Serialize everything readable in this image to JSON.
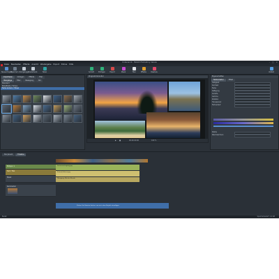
{
  "app": {
    "title": "Unbenannt - MAGIX Photostory deluxe"
  },
  "menu": [
    "Datei",
    "Bearbeiten",
    "Effekte",
    "Ansicht",
    "Wiedergabe",
    "Export",
    "Extras",
    "Hilfe"
  ],
  "toolbar": [
    {
      "label": "Neues Projekt",
      "icon": "new-project-icon",
      "color": "#5a8fd0"
    },
    {
      "label": "Speichern",
      "icon": "save-icon",
      "color": "#6f7d8c"
    },
    {
      "label": "Rückgängig",
      "icon": "undo-icon",
      "color": "#c5cdd6"
    },
    {
      "label": "Wiederherst.",
      "icon": "redo-icon",
      "color": "#c5cdd6"
    },
    {
      "label": "Teilen",
      "icon": "share-icon",
      "color": "#2fa3a3"
    },
    {
      "label": "Schnitt",
      "icon": "cut-icon",
      "color": "#2fb27a"
    },
    {
      "label": "Einfügen",
      "icon": "insert-icon",
      "color": "#2fb27a"
    },
    {
      "label": "Export",
      "icon": "export-icon",
      "color": "#d64a4a"
    },
    {
      "label": "Musik",
      "icon": "music-icon",
      "color": "#c54bd0"
    },
    {
      "label": "Titel",
      "icon": "title-icon",
      "color": "#e0e4e8"
    },
    {
      "label": "Effekte",
      "icon": "effects-icon",
      "color": "#e0a030"
    },
    {
      "label": "Diashow",
      "icon": "slideshow-icon",
      "color": "#e04a6a"
    },
    {
      "label": "Vollbild",
      "icon": "fullscreen-icon",
      "color": "#5aa0e0"
    }
  ],
  "left_panel": {
    "tabs": [
      "Importieren",
      "Vorlagen",
      "Effekte",
      "Titel"
    ],
    "subtabs": [
      "Übergänge",
      "Filter",
      "Bewegung",
      "Stil"
    ],
    "list": [
      "Standard",
      "Bildeffekte / Farben",
      "Farbe ändern / Tönen"
    ],
    "thumb_colors": [
      "#9aa3ad",
      "#4e7ca8",
      "#c08a4a",
      "#6f8a5a",
      "#e0e4e8",
      "#3d5f86",
      "#8b6b4a",
      "#a0a8b0",
      "#5a6470",
      "#b77a3a",
      "#7fa2c2",
      "#d8dee6",
      "#48698c",
      "#c29a5a",
      "#9ab07a",
      "#6a7480",
      "#8a929c",
      "#3f5f7f",
      "#d0a060",
      "#c8ced6",
      "#586470",
      "#aab3bd",
      "#7c8894",
      "#44607e"
    ],
    "selected_thumb": 8
  },
  "preview": {
    "title": "Programmmonitor",
    "zoom": "100 %",
    "time": "00:00:00:00"
  },
  "properties": {
    "title": "Eigenschaften",
    "tabs": [
      "Farbkorrektur",
      "Effekt"
    ],
    "rows": [
      "Helligkeit",
      "Kontrast",
      "Farbe",
      "Sättigung",
      "Schärfe",
      "Gamma",
      "Rotation",
      "Transparenz",
      "Farbverlauf"
    ],
    "sliders": [
      "Stärke",
      "Weichzeichnen"
    ]
  },
  "timeline": {
    "tabs": [
      "Storyboard",
      "Timeline"
    ],
    "tracks": [
      "Bildspur 1",
      "Text / Titel",
      "Musik",
      "Kommentar"
    ],
    "clip_labels": [
      "Sonnenuntergang.jpg",
      "Strand_Palmen.jpg",
      "Übergang: Weiche Blende"
    ],
    "drop_hint": "Ziehen Sie Dateien hierher, um sie in das Projekt einzufügen"
  },
  "status": {
    "right": "Speicherbedarf: 2,4 GB",
    "left": "Bereit"
  }
}
